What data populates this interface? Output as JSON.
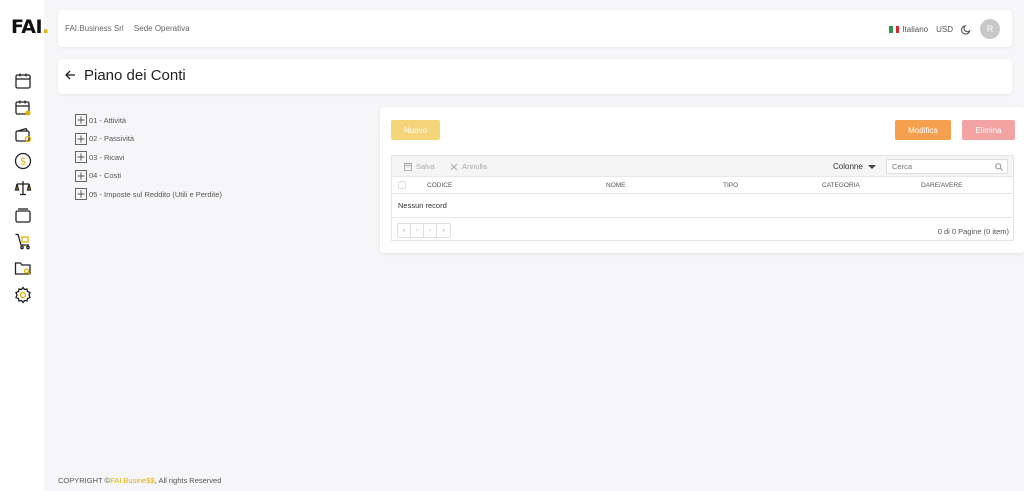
{
  "app": {
    "logo_text": "FAI",
    "logo_dot": "."
  },
  "sidebar": {
    "items": [
      {
        "icon": "calendar-icon"
      },
      {
        "icon": "calendar-user-icon"
      },
      {
        "icon": "wallet-settings-icon"
      },
      {
        "icon": "dollar-coin-icon"
      },
      {
        "icon": "balance-scale-icon"
      },
      {
        "icon": "cards-stack-icon"
      },
      {
        "icon": "cart-icon"
      },
      {
        "icon": "folder-search-icon"
      },
      {
        "icon": "gear-icon"
      }
    ]
  },
  "header": {
    "company": "FAI.Business Srl",
    "location": "Sede Operativa",
    "language": "Italiano",
    "currency": "USD",
    "avatar_initial": "R"
  },
  "page": {
    "title": "Piano dei Conti"
  },
  "tree": {
    "items": [
      {
        "label": "01 - Attività"
      },
      {
        "label": "02 - Passività"
      },
      {
        "label": "03 - Ricavi"
      },
      {
        "label": "04 - Costi"
      },
      {
        "label": "05 - Imposte sul Reddito (Utili e Perdite)"
      }
    ]
  },
  "actions": {
    "new_label": "Nuovo",
    "edit_label": "Modifica",
    "delete_label": "Elimina"
  },
  "grid": {
    "toolbar": {
      "save_label": "Salva",
      "cancel_label": "Annulla",
      "columns_label": "Colonne",
      "search_placeholder": "Cerca"
    },
    "columns": [
      "CODICE",
      "NOME",
      "TIPO",
      "CATEGORIA",
      "DARE/AVERE"
    ],
    "empty_text": "Nessun record",
    "pager": [
      "«",
      "‹",
      "›",
      "»"
    ],
    "page_info": "0 di 0 Pagine (0 item)"
  },
  "footer": {
    "prefix": "COPYRIGHT ©",
    "brand": "FAI.Busine$$",
    "suffix": ", All rights Reserved"
  },
  "colors": {
    "accent": "#e2b000",
    "new_button": "#f5d47a",
    "edit_button": "#f5a04e",
    "delete_button": "#f3a3a1"
  }
}
